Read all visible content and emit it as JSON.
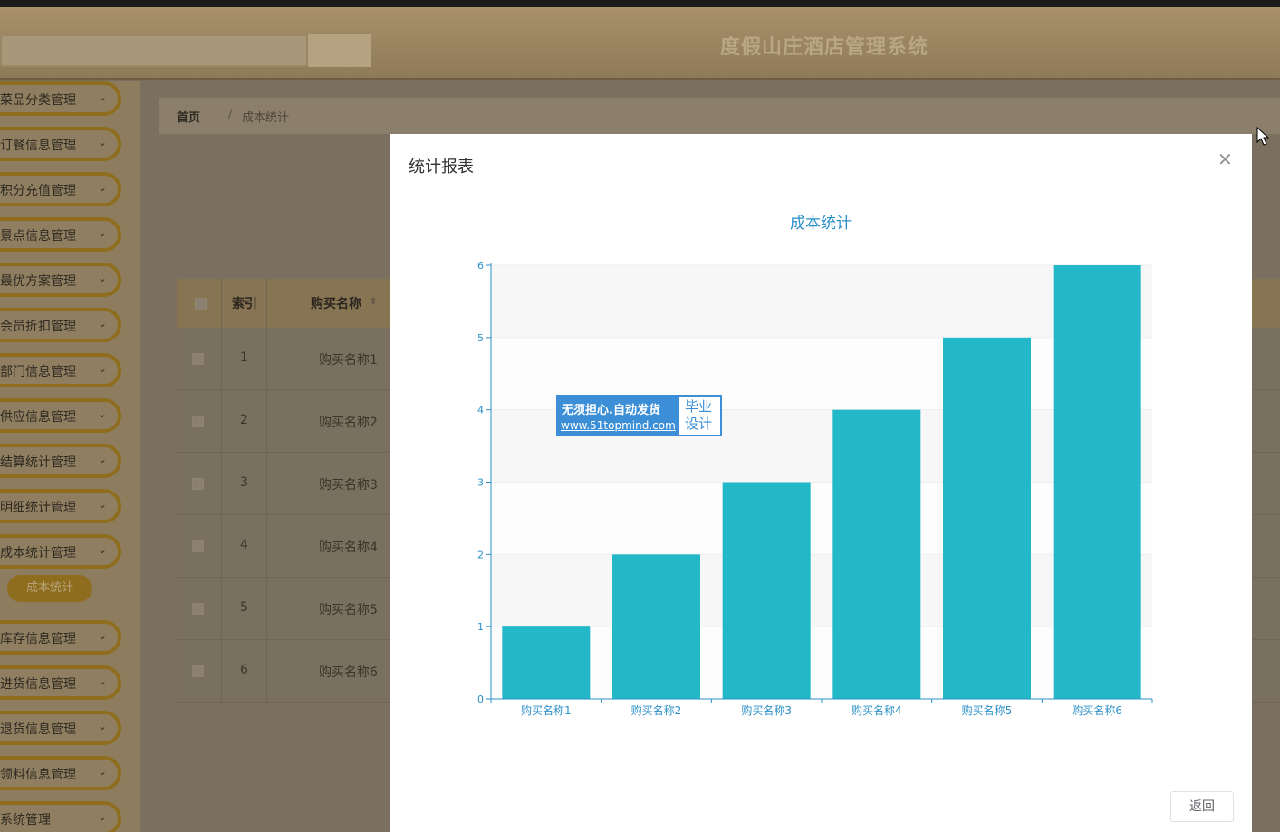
{
  "app": {
    "title": "度假山庄酒店管理系统"
  },
  "sidebar": {
    "items": [
      {
        "label": "菜品分类管理"
      },
      {
        "label": "订餐信息管理"
      },
      {
        "label": "积分充值管理"
      },
      {
        "label": "景点信息管理"
      },
      {
        "label": "最优方案管理"
      },
      {
        "label": "会员折扣管理"
      },
      {
        "label": "部门信息管理"
      },
      {
        "label": "供应信息管理"
      },
      {
        "label": "结算统计管理"
      },
      {
        "label": "明细统计管理"
      },
      {
        "label": "成本统计管理"
      },
      {
        "label": "库存信息管理"
      },
      {
        "label": "进货信息管理"
      },
      {
        "label": "退货信息管理"
      },
      {
        "label": "领料信息管理"
      },
      {
        "label": "系统管理"
      }
    ],
    "active_sub": "成本统计"
  },
  "breadcrumb": {
    "home": "首页",
    "separator": "/",
    "current": "成本统计"
  },
  "table": {
    "headers": {
      "index": "索引",
      "name": "购买名称"
    },
    "rows": [
      {
        "index": "1",
        "name": "购买名称1"
      },
      {
        "index": "2",
        "name": "购买名称2"
      },
      {
        "index": "3",
        "name": "购买名称3"
      },
      {
        "index": "4",
        "name": "购买名称4"
      },
      {
        "index": "5",
        "name": "购买名称5"
      },
      {
        "index": "6",
        "name": "购买名称6"
      }
    ]
  },
  "modal": {
    "title": "统计报表",
    "close_icon": "close-icon",
    "back_label": "返回"
  },
  "watermark": {
    "line1": "无须担心.自动发货",
    "line2": "www.51topmind.com",
    "side1": "毕业",
    "side2": "设计"
  },
  "chart_data": {
    "type": "bar",
    "title": "成本统计",
    "categories": [
      "购买名称1",
      "购买名称2",
      "购买名称3",
      "购买名称4",
      "购买名称5",
      "购买名称6"
    ],
    "values": [
      1,
      2,
      3,
      4,
      5,
      6
    ],
    "ylim": [
      0,
      6
    ],
    "yticks": [
      0,
      1,
      2,
      3,
      4,
      5,
      6
    ],
    "grid": true,
    "colors": {
      "bar": "#22b8c8",
      "axis": "#2b90c8",
      "title": "#2b90c8",
      "band": "#f7f7f7"
    }
  }
}
